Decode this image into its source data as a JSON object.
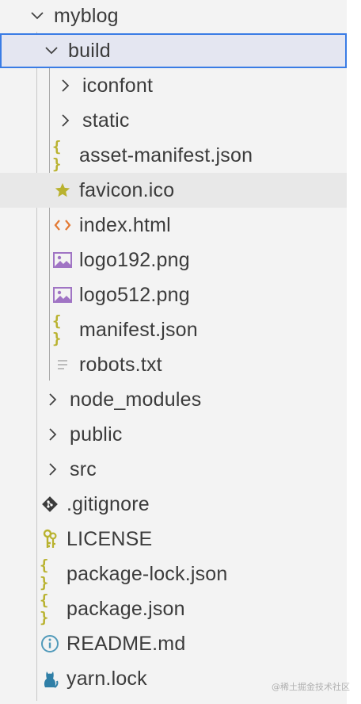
{
  "tree": {
    "root": {
      "label": "myblog",
      "expanded": true
    },
    "build": {
      "label": "build",
      "expanded": true,
      "children": [
        {
          "label": "iconfont",
          "icon": "chevron-right-icon"
        },
        {
          "label": "static",
          "icon": "chevron-right-icon"
        },
        {
          "label": "asset-manifest.json",
          "icon": "json-icon"
        },
        {
          "label": "favicon.ico",
          "icon": "star-icon"
        },
        {
          "label": "index.html",
          "icon": "html-icon"
        },
        {
          "label": "logo192.png",
          "icon": "image-icon"
        },
        {
          "label": "logo512.png",
          "icon": "image-icon"
        },
        {
          "label": "manifest.json",
          "icon": "json-icon"
        },
        {
          "label": "robots.txt",
          "icon": "text-file-icon"
        }
      ]
    },
    "siblings": [
      {
        "label": "node_modules",
        "icon": "chevron-right-icon"
      },
      {
        "label": "public",
        "icon": "chevron-right-icon"
      },
      {
        "label": "src",
        "icon": "chevron-right-icon"
      },
      {
        "label": ".gitignore",
        "icon": "git-icon"
      },
      {
        "label": "LICENSE",
        "icon": "license-key-icon"
      },
      {
        "label": "package-lock.json",
        "icon": "json-icon"
      },
      {
        "label": "package.json",
        "icon": "json-icon"
      },
      {
        "label": "README.md",
        "icon": "info-icon"
      },
      {
        "label": "yarn.lock",
        "icon": "yarn-cat-icon"
      }
    ]
  },
  "icon_glyphs": {
    "json_braces": "{ }"
  },
  "colors": {
    "selection_outline": "#3a7ce5",
    "json": "#b9b22f",
    "html": "#e37933",
    "image": "#a074c4",
    "git": "#3b3b3b",
    "info": "#519aba"
  },
  "watermark": "@稀土掘金技术社区"
}
